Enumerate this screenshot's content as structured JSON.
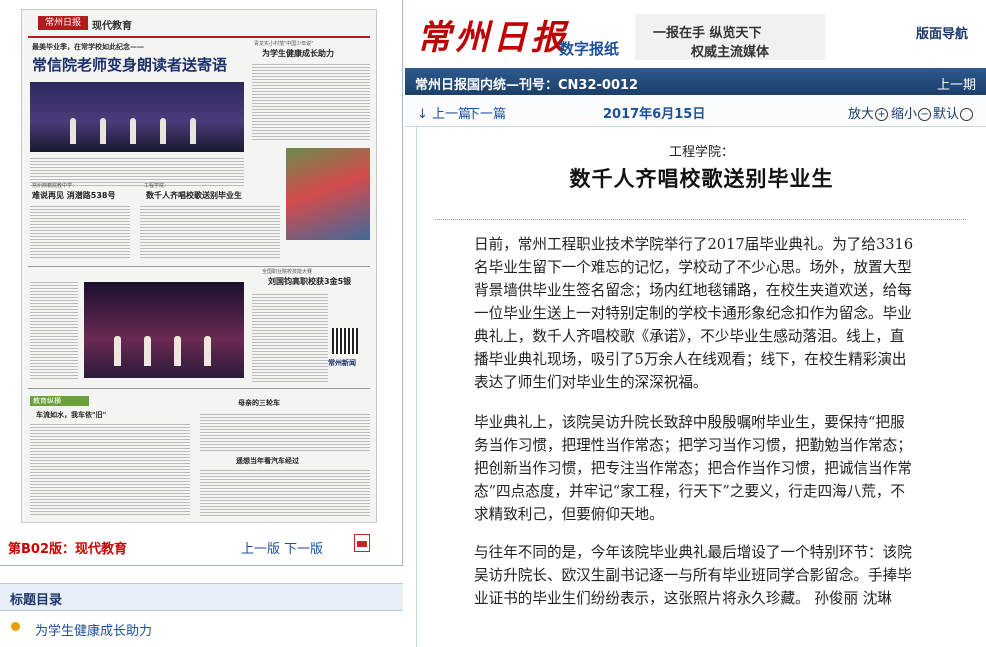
{
  "newspaper": {
    "logo": "常州日报",
    "section": "现代教育",
    "page_no": "B2",
    "headlines": {
      "main_kicker": "最美毕业季，在常学校如此纪念——",
      "main": "常信院老师变身朗读者送寄语",
      "right_kicker": "青龙实小村落\"中国少年说\"",
      "right": "为学生健康成长助力",
      "mid_left_kicker": "常州西籍院教中学：",
      "mid_left": "难说再见  消潜路538号",
      "mid_right_kicker": "工程学院：",
      "mid_right": "数千人齐唱校歌送别毕业生",
      "vocational_kicker": "全国职业院校技能大赛",
      "vocational": "刘国钧高职校获3金5银",
      "bottom_left_kicker": "教育纵横",
      "bottom_left": "车流如水，我车依\"旧\"",
      "bottom_right": "母亲的三轮车",
      "bottom_right2": "遥想当年看汽车经过",
      "brand_small": "常州新闻"
    }
  },
  "page_footer": {
    "edition": "第B02版：现代教育",
    "prev": "上一版",
    "next": "下一版"
  },
  "title_list": {
    "header": "标题目录",
    "items": [
      {
        "label": "为学生健康成长助力"
      }
    ]
  },
  "masthead": {
    "logo": "常州日报",
    "subtitle": "数字报纸",
    "slogan1": "一报在手  纵览天下",
    "slogan2": "权威主流媒体",
    "nav": "版面导航"
  },
  "info_bar": {
    "text": "常州日报国内统—刊号：CN32-0012",
    "prev_issue": "上一期"
  },
  "toolbar": {
    "prev_article": "上一篇",
    "next_article": "下一篇",
    "date": "2017年6月15日",
    "zoom_in": "放大",
    "zoom_out": "缩小",
    "reset": "默认"
  },
  "article": {
    "pre_title": "工程学院：",
    "title": "数千人齐唱校歌送别毕业生",
    "paragraphs": [
      "日前，常州工程职业技术学院举行了2017届毕业典礼。为了给3316名毕业生留下一个难忘的记忆，学校动了不少心思。场外，放置大型背景墙供毕业生签名留念；场内红地毯铺路，在校生夹道欢送，给每一位毕业生送上一对特别定制的学校卡通形象纪念扣作为留念。毕业典礼上，数千人齐唱校歌《承诺》，不少毕业生感动落泪。线上，直播毕业典礼现场，吸引了5万余人在线观看；线下，在校生精彩演出表达了师生们对毕业生的深深祝福。",
      "毕业典礼上，该院吴访升院长致辞中殷殷嘱咐毕业生，要保持“把服务当作习惯，把理性当作常态；把学习当作习惯，把勤勉当作常态；把创新当作习惯，把专注当作常态；把合作当作习惯，把诚信当作常态”四点态度，并牢记“家工程，行天下”之要义，行走四海八荒，不求精致利己，但要俯仰天地。",
      "与往年不同的是，今年该院毕业典礼最后增设了一个特别环节：该院吴访升院长、欧汉生副书记逐一与所有毕业班同学合影留念。手捧毕业证书的毕业生们纷纷表示，这张照片将永久珍藏。  孙俊丽 沈琳"
    ]
  },
  "colors": {
    "brand_red": "#c00000",
    "link_blue": "#1c4f9c",
    "bar_blue": "#2d5a8c",
    "bullet_orange": "#e8a000"
  },
  "icons": [
    "pdf-icon",
    "plus-circle-icon",
    "minus-circle-icon",
    "reset-circle-icon",
    "bullet-icon"
  ]
}
